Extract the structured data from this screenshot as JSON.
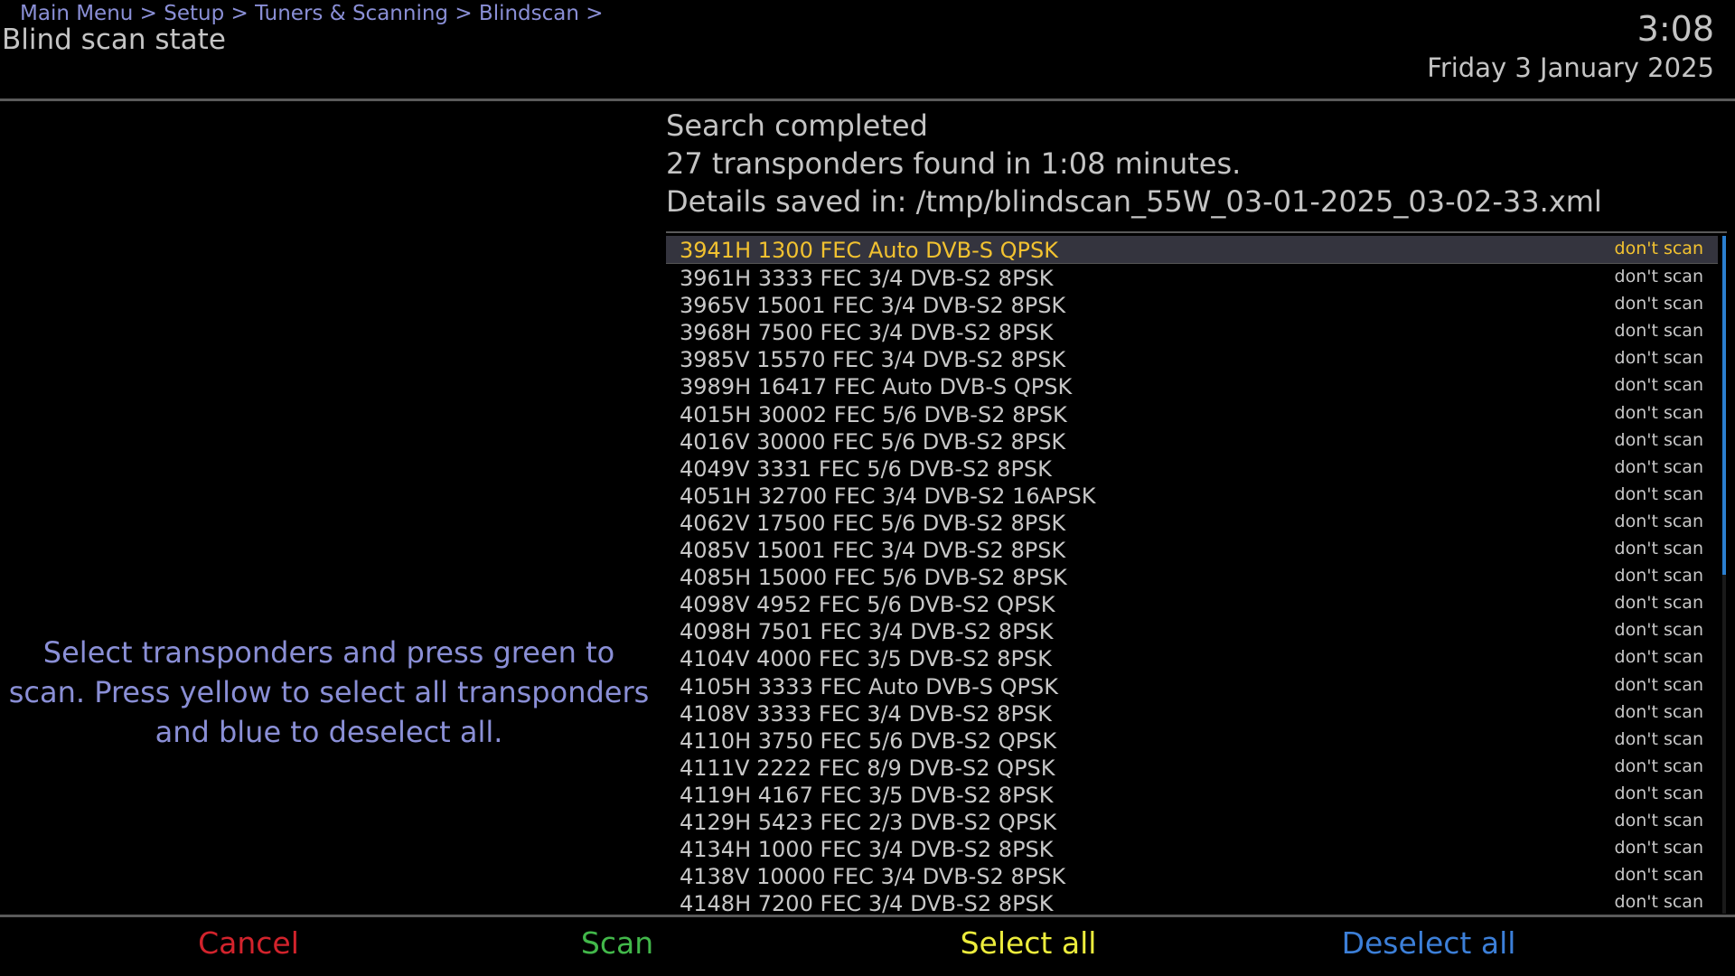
{
  "header": {
    "breadcrumb": "Main Menu > Setup > Tuners & Scanning > Blindscan >",
    "title": "Blind scan state",
    "time": "3:08",
    "date": "Friday 3 January 2025"
  },
  "hint": {
    "text": "Select transponders and press green to scan. Press yellow to select all transponders and blue to deselect all."
  },
  "status": {
    "line1": "Search completed",
    "line2": "27 transponders found in 1:08 minutes.",
    "line3": "Details saved in: /tmp/blindscan_55W_03-01-2025_03-02-33.xml"
  },
  "transponders": [
    {
      "label": "3941H 1300 FEC Auto DVB-S QPSK",
      "state": "don't scan",
      "selected": true
    },
    {
      "label": "3961H 3333 FEC 3/4 DVB-S2 8PSK",
      "state": "don't scan"
    },
    {
      "label": "3965V 15001 FEC 3/4 DVB-S2 8PSK",
      "state": "don't scan"
    },
    {
      "label": "3968H 7500 FEC 3/4 DVB-S2 8PSK",
      "state": "don't scan"
    },
    {
      "label": "3985V 15570 FEC 3/4 DVB-S2 8PSK",
      "state": "don't scan"
    },
    {
      "label": "3989H 16417 FEC Auto DVB-S QPSK",
      "state": "don't scan"
    },
    {
      "label": "4015H 30002 FEC 5/6 DVB-S2 8PSK",
      "state": "don't scan"
    },
    {
      "label": "4016V 30000 FEC 5/6 DVB-S2 8PSK",
      "state": "don't scan"
    },
    {
      "label": "4049V 3331 FEC 5/6 DVB-S2 8PSK",
      "state": "don't scan"
    },
    {
      "label": "4051H 32700 FEC 3/4 DVB-S2 16APSK",
      "state": "don't scan"
    },
    {
      "label": "4062V 17500 FEC 5/6 DVB-S2 8PSK",
      "state": "don't scan"
    },
    {
      "label": "4085V 15001 FEC 3/4 DVB-S2 8PSK",
      "state": "don't scan"
    },
    {
      "label": "4085H 15000 FEC 5/6 DVB-S2 8PSK",
      "state": "don't scan"
    },
    {
      "label": "4098V 4952 FEC 5/6 DVB-S2 QPSK",
      "state": "don't scan"
    },
    {
      "label": "4098H 7501 FEC 3/4 DVB-S2 8PSK",
      "state": "don't scan"
    },
    {
      "label": "4104V 4000 FEC 3/5 DVB-S2 8PSK",
      "state": "don't scan"
    },
    {
      "label": "4105H 3333 FEC Auto DVB-S QPSK",
      "state": "don't scan"
    },
    {
      "label": "4108V 3333 FEC 3/4 DVB-S2 8PSK",
      "state": "don't scan"
    },
    {
      "label": "4110H 3750 FEC 5/6 DVB-S2 QPSK",
      "state": "don't scan"
    },
    {
      "label": "4111V 2222 FEC 8/9 DVB-S2 QPSK",
      "state": "don't scan"
    },
    {
      "label": "4119H 4167 FEC 3/5 DVB-S2 8PSK",
      "state": "don't scan"
    },
    {
      "label": "4129H 5423 FEC 2/3 DVB-S2 QPSK",
      "state": "don't scan"
    },
    {
      "label": "4134H 1000 FEC 3/4 DVB-S2 8PSK",
      "state": "don't scan"
    },
    {
      "label": "4138V 10000 FEC 3/4 DVB-S2 8PSK",
      "state": "don't scan"
    },
    {
      "label": "4148H 7200 FEC 3/4 DVB-S2 8PSK",
      "state": "don't scan"
    }
  ],
  "footer": {
    "red": "Cancel",
    "green": "Scan",
    "yellow": "Select all",
    "blue": "Deselect all"
  },
  "colors": {
    "selected_text": "#f2c230",
    "hint_text": "#8a8fd6",
    "red_key": "#d2232c",
    "green_key": "#42b84a",
    "yellow_key": "#ecec3c",
    "blue_key": "#3c7fd8",
    "scrollbar": "#2b7fd0"
  }
}
